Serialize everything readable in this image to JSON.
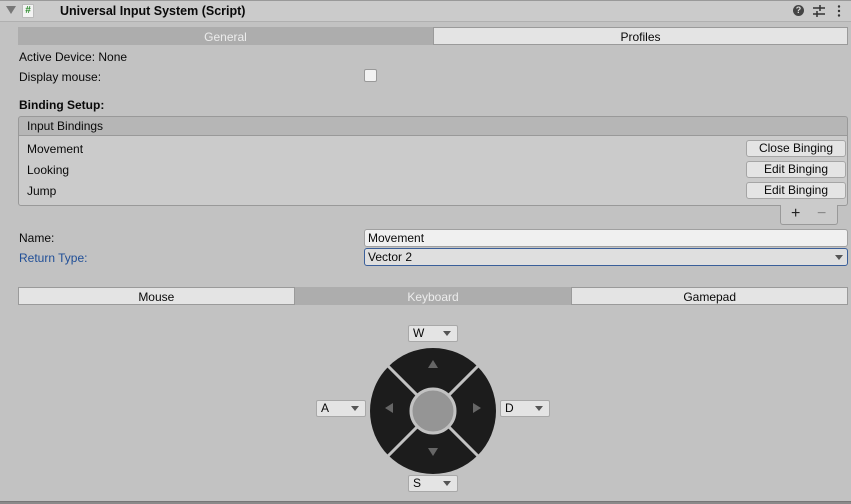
{
  "header": {
    "title": "Universal Input System (Script)",
    "script_icon_glyph": "#",
    "icons": [
      "foldout-arrow-icon",
      "script-icon",
      "help-icon",
      "presets-icon",
      "more-menu-icon"
    ]
  },
  "top_tabs": [
    {
      "label": "General",
      "active": true
    },
    {
      "label": "Profiles",
      "active": false
    }
  ],
  "general": {
    "active_device_label": "Active Device: None",
    "display_mouse_label": "Display mouse:",
    "display_mouse_checked": false,
    "binding_setup_label": "Binding Setup:"
  },
  "bindings": {
    "header": "Input Bindings",
    "items": [
      {
        "name": "Movement",
        "button": "Close Binging"
      },
      {
        "name": "Looking",
        "button": "Edit Binging"
      },
      {
        "name": "Jump",
        "button": "Edit Binging"
      }
    ],
    "add_label": "+",
    "remove_label": "−"
  },
  "fields": {
    "name_label": "Name:",
    "name_value": "Movement",
    "return_type_label": "Return Type:",
    "return_type_value": "Vector 2",
    "return_type_color": "#1f4e97"
  },
  "device_tabs": [
    {
      "label": "Mouse",
      "active": false
    },
    {
      "label": "Keyboard",
      "active": true
    },
    {
      "label": "Gamepad",
      "active": false
    }
  ],
  "keys": {
    "up": "W",
    "left": "A",
    "right": "D",
    "down": "S"
  }
}
